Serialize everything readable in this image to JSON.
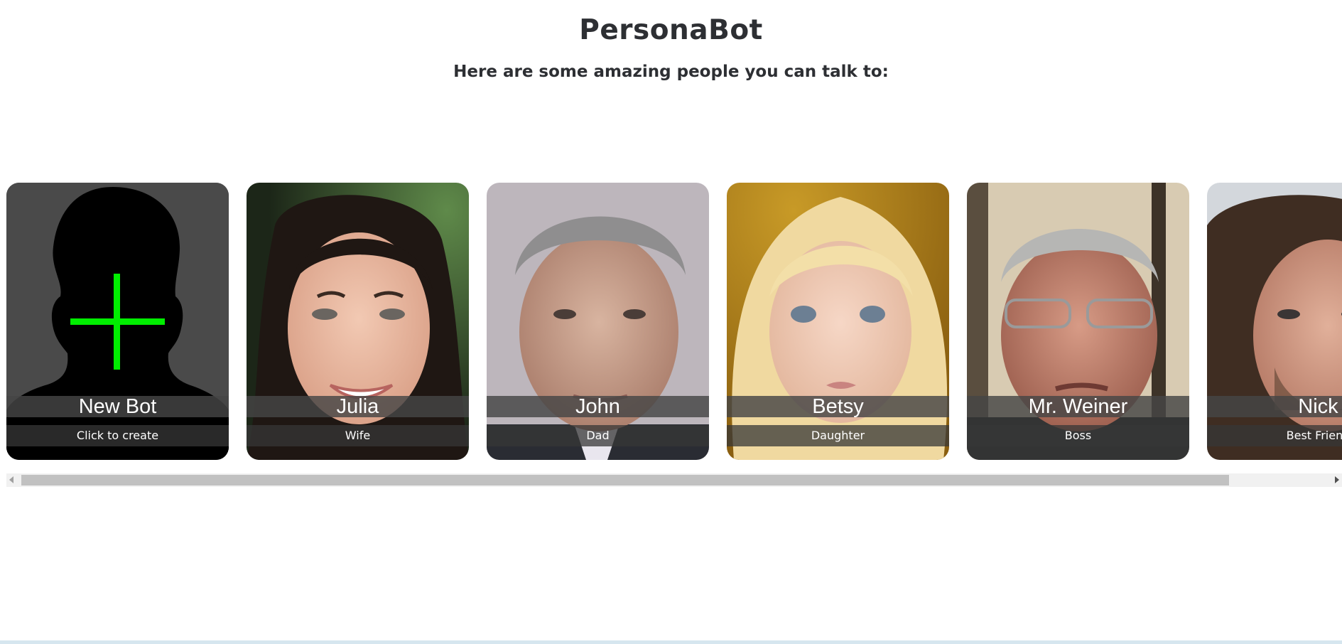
{
  "app": {
    "title": "PersonaBot",
    "subtitle": "Here are some amazing people you can talk to:"
  },
  "cards": [
    {
      "name": "New Bot",
      "role": "Click to create",
      "icon": "plus-icon",
      "accent": "#00ee00"
    },
    {
      "name": "Julia",
      "role": "Wife"
    },
    {
      "name": "John",
      "role": "Dad"
    },
    {
      "name": "Betsy",
      "role": "Daughter"
    },
    {
      "name": "Mr. Weiner",
      "role": "Boss"
    },
    {
      "name": "Nick",
      "role": "Best Friend"
    }
  ]
}
